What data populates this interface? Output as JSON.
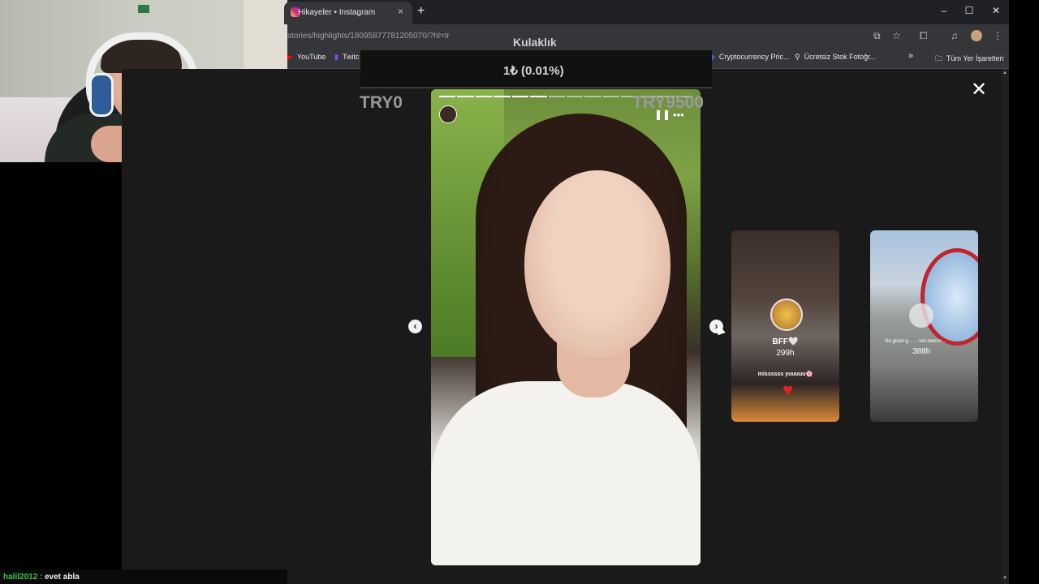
{
  "browser": {
    "tab_title": "Hikayeler • Instagram",
    "tab_close": "×",
    "new_tab": "+",
    "url": "stories/highlights/18095877781205070/?hl=tr",
    "window_buttons": [
      "–",
      "☐",
      "✕"
    ],
    "toolbar_icons": [
      "install-icon",
      "star-icon",
      "extensions-icon",
      "media-icon",
      "profile-icon",
      "menu-icon"
    ],
    "bookmarks": [
      {
        "label": "YouTube",
        "icon": "youtube-icon",
        "color": "#ff0000"
      },
      {
        "label": "Twitc",
        "icon": "twitch-icon",
        "color": "#9146ff"
      },
      {
        "label": "Cryptocurrency Pric...",
        "icon": "crypto-icon",
        "color": "#3861fb"
      },
      {
        "label": "Ücretsiz Stok Fotoğr...",
        "icon": "photo-icon",
        "color": "#ffffff"
      }
    ],
    "bookmarks_more": "»",
    "all_bookmarks": "Tüm Yer İşaretleri"
  },
  "overlay": {
    "goal_title": "Kulaklık",
    "goal_value": "1₺ (0.01%)",
    "goal_min": "TRY0",
    "goal_max": "TRY9500"
  },
  "story": {
    "pause_icon": "❚❚",
    "more_icon": "•••",
    "progress_segments": 14,
    "prev_icon": "‹",
    "next_icon": "›"
  },
  "close_icon": "✕",
  "previews": [
    {
      "name": "BFF🤍",
      "time": "299h",
      "caption": "missssss yuuuuu🌸"
    },
    {
      "caption": "Ne güzel g... ... sen benim...",
      "time": "388h"
    }
  ],
  "chat": {
    "user": "halil2012 :",
    "message": "evet abla"
  }
}
